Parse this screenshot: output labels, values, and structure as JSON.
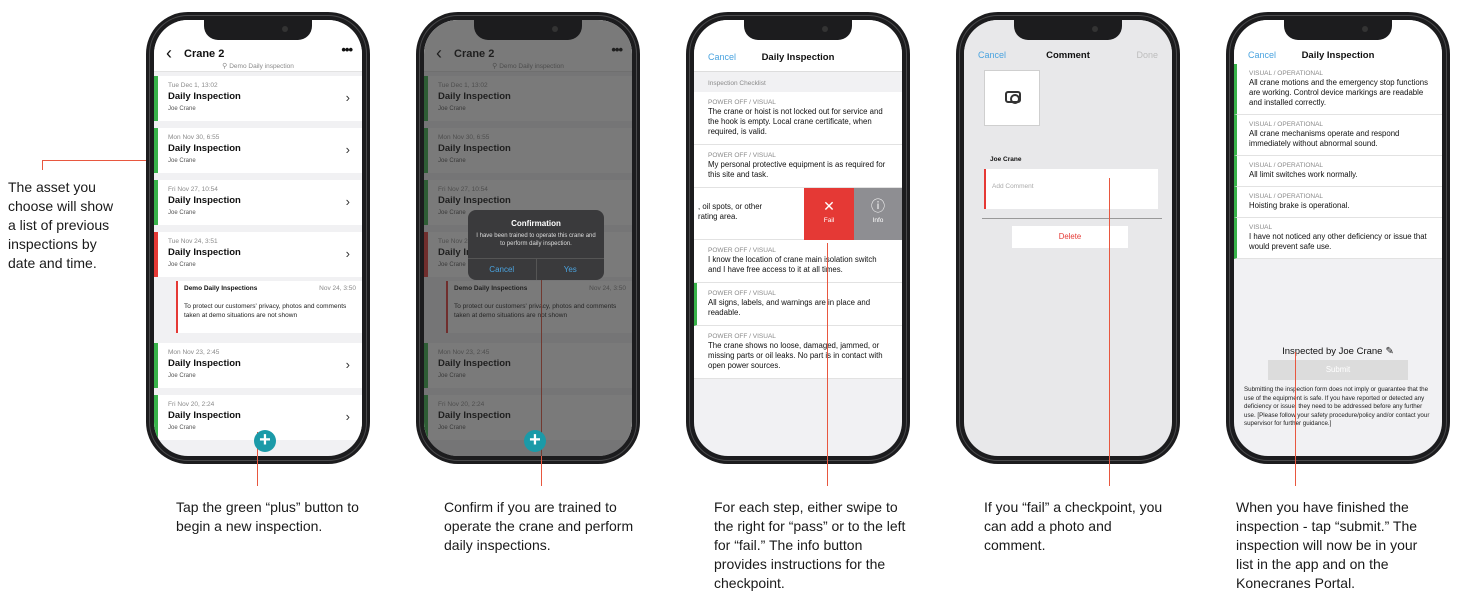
{
  "side_note": "The asset you choose will show a list of previous inspections by date and time.",
  "captions": [
    "Tap the green “plus” button to begin a new inspection.",
    "Confirm if you are trained to operate the crane and perform daily inspections.",
    "For each step, either swipe to the right for “pass” or to the left for “fail.” The info button provides instructions for the checkpoint.",
    "If you “fail” a checkpoint, you can add a photo and comment.",
    "When you have finished the inspection - tap “submit.” The inspection will now be in your list in the app and on the Konecranes Portal."
  ],
  "colors": {
    "accent_red": "#e53935",
    "pass_green": "#38b34a",
    "fab_teal": "#1b9aa8",
    "link_blue": "#4aa3df",
    "leader_line": "#e8573f"
  },
  "list_screen": {
    "title": "Crane 2",
    "location": "Demo Daily inspection",
    "icons": {
      "back": "chevron-left-icon",
      "more": "more-icon",
      "location": "pin-icon",
      "add": "plus-icon"
    },
    "entries": [
      {
        "date": "Tue Dec 1, 13:02",
        "title": "Daily Inspection",
        "user": "Joe Crane",
        "status": "pass"
      },
      {
        "date": "Mon Nov 30, 6:55",
        "title": "Daily Inspection",
        "user": "Joe Crane",
        "status": "pass"
      },
      {
        "date": "Fri Nov 27, 10:54",
        "title": "Daily Inspection",
        "user": "Joe Crane",
        "status": "pass"
      },
      {
        "date": "Tue Nov 24, 3:51",
        "title": "Daily Inspection",
        "user": "Joe Crane",
        "status": "fail"
      },
      {
        "date": "Mon Nov 23, 2:45",
        "title": "Daily Inspection",
        "user": "Joe Crane",
        "status": "pass"
      },
      {
        "date": "Fri Nov 20, 2:24",
        "title": "Daily Inspection",
        "user": "Joe Crane",
        "status": "pass"
      }
    ],
    "sub_note": {
      "title": "Demo Daily Inspections",
      "date": "Nov 24, 3:50",
      "message": "To protect our customers' privacy, photos and comments taken at demo situations are not shown"
    }
  },
  "confirm_dialog": {
    "title": "Confirmation",
    "body": "I have been trained to operate this crane and to perform daily inspection.",
    "cancel": "Cancel",
    "yes": "Yes"
  },
  "checklist_screen": {
    "cancel": "Cancel",
    "title": "Daily Inspection",
    "section": "Inspection Checklist",
    "items": [
      {
        "category": "POWER OFF / VISUAL",
        "text": "The crane or hoist is not locked out for service and the hook is empty. Local crane certificate, when required, is valid."
      },
      {
        "category": "POWER OFF / VISUAL",
        "text": "My personal protective equipment is as required for this site and task."
      },
      {
        "category": "POWER OFF / VISUAL",
        "text": "I know the location of crane main isolation switch and I have free access to it at all times."
      },
      {
        "category": "POWER OFF / VISUAL",
        "text": "All signs, labels, and warnings are in place and readable."
      },
      {
        "category": "POWER OFF / VISUAL",
        "text": "The crane shows no loose, damaged, jammed, or missing parts or oil leaks. No part is in contact with open power sources."
      }
    ],
    "swiped_partial": ", oil spots, or other\nrating area.",
    "fail_label": "Fail",
    "info_label": "Info"
  },
  "comment_screen": {
    "cancel": "Cancel",
    "title": "Comment",
    "done": "Done",
    "user": "Joe Crane",
    "placeholder": "Add Comment",
    "delete": "Delete"
  },
  "submit_screen": {
    "cancel": "Cancel",
    "title": "Daily Inspection",
    "items": [
      {
        "category": "VISUAL / OPERATIONAL",
        "text": "All crane motions and the emergency stop functions are working. Control device markings are readable and installed correctly."
      },
      {
        "category": "VISUAL / OPERATIONAL",
        "text": "All crane mechanisms operate and respond immediately without abnormal sound."
      },
      {
        "category": "VISUAL / OPERATIONAL",
        "text": "All limit switches work normally."
      },
      {
        "category": "VISUAL / OPERATIONAL",
        "text": "Hoisting brake is operational."
      },
      {
        "category": "VISUAL",
        "text": "I have not noticed any other deficiency or issue that would prevent safe use."
      }
    ],
    "inspected_by": "Inspected by Joe Crane",
    "submit": "Submit",
    "disclaimer": "Submitting the inspection form does not imply or guarantee that the use of the equipment is safe. If you have reported or detected any deficiency or issue, they need to be addressed before any further use. [Please follow your safety procedure/policy and/or contact your supervisor for further guidance.]"
  }
}
